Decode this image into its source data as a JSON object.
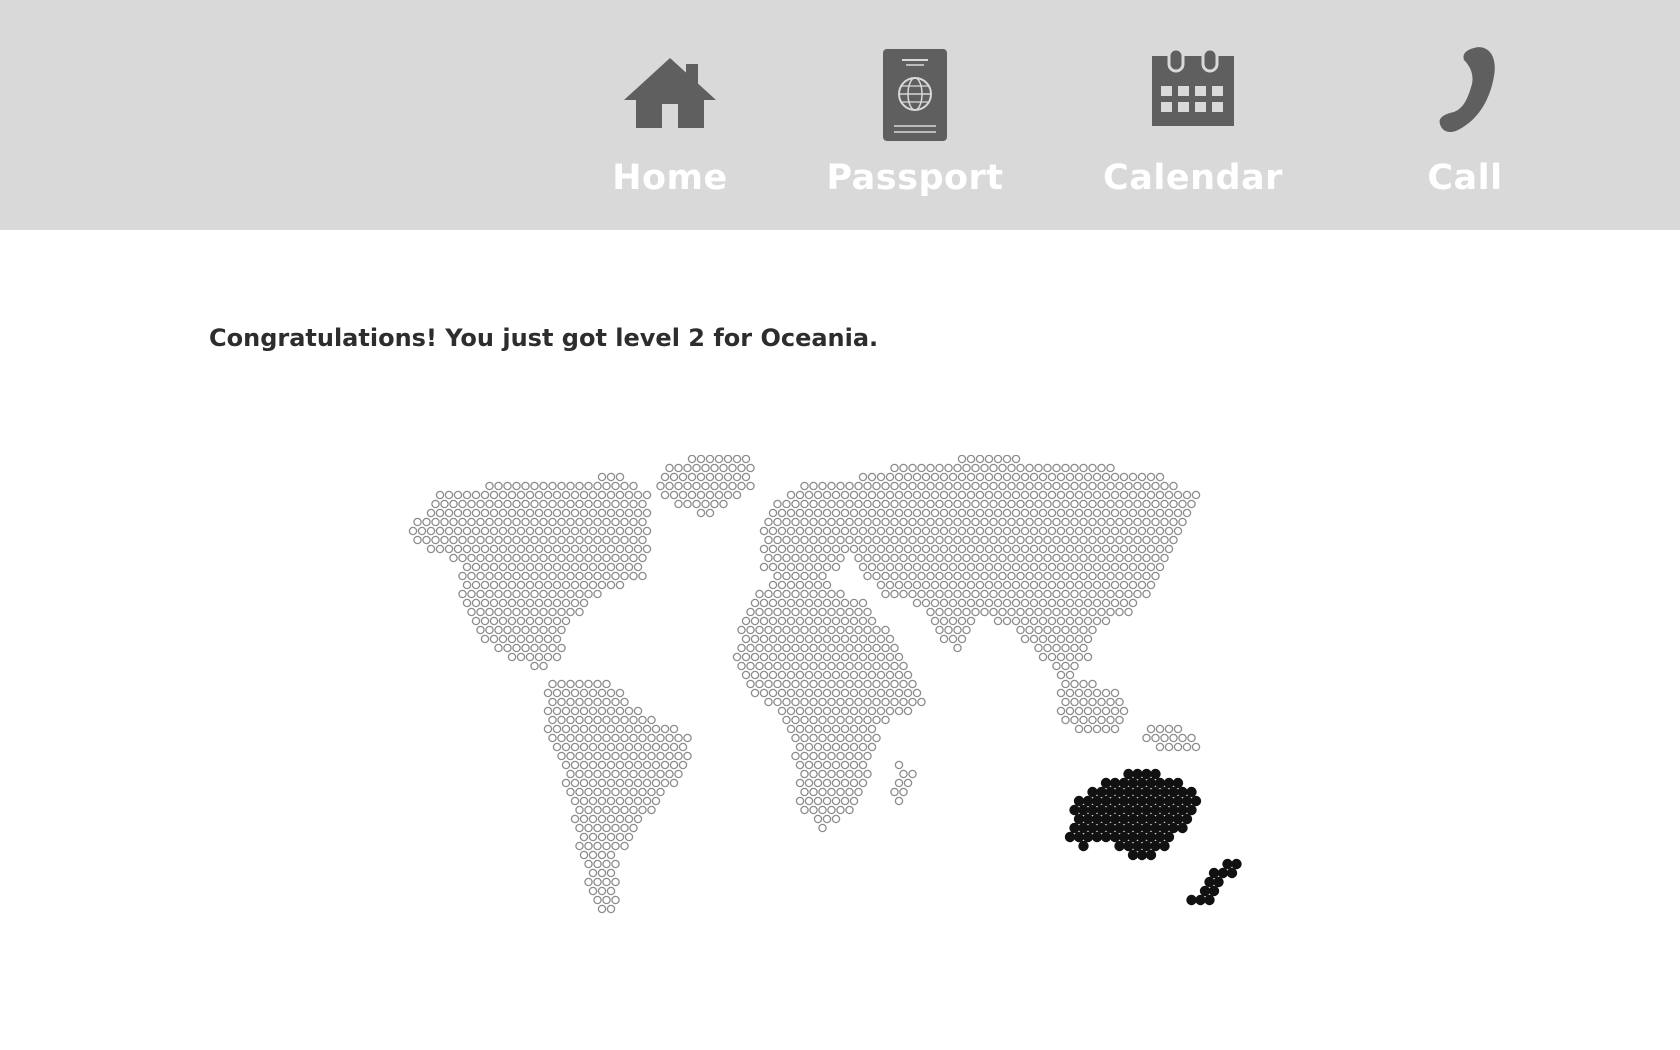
{
  "nav": {
    "items": [
      {
        "id": "home",
        "label": "Home",
        "icon": "house-icon"
      },
      {
        "id": "passport",
        "label": "Passport",
        "icon": "passport-icon"
      },
      {
        "id": "calendar",
        "label": "Calendar",
        "icon": "calendar-icon"
      },
      {
        "id": "call",
        "label": "Call",
        "icon": "phone-icon"
      }
    ]
  },
  "main": {
    "message": "Congratulations! You just got level 2 for Oceania."
  },
  "map": {
    "highlighted_region": "Oceania"
  },
  "colors": {
    "topbar": "#d9d9d9",
    "icon": "#5f5f5f",
    "nav_label": "#ffffff",
    "message": "#2d2d2d",
    "dot_outline": "#8c8c8c",
    "dot_highlight": "#111111"
  }
}
